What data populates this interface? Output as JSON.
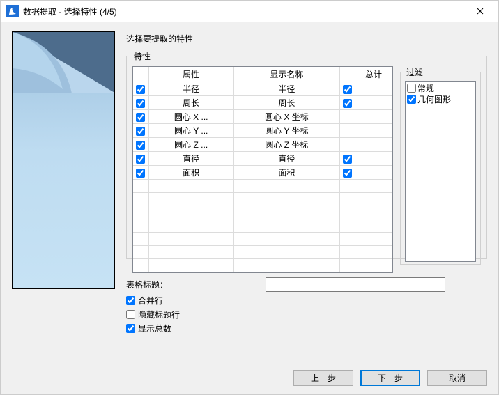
{
  "window": {
    "title": "数据提取 - 选择特性 (4/5)"
  },
  "instruction": "选择要提取的特性",
  "properties": {
    "legend": "特性",
    "headers": {
      "attr": "属性",
      "display": "显示名称",
      "total": "总计"
    },
    "rows": [
      {
        "checked": true,
        "attr": "半径",
        "display": "半径",
        "total": true
      },
      {
        "checked": true,
        "attr": "周长",
        "display": "周长",
        "total": true
      },
      {
        "checked": true,
        "attr": "圆心 X ...",
        "display": "圆心 X 坐标",
        "total": null
      },
      {
        "checked": true,
        "attr": "圆心 Y ...",
        "display": "圆心 Y 坐标",
        "total": null
      },
      {
        "checked": true,
        "attr": "圆心 Z ...",
        "display": "圆心 Z 坐标",
        "total": null
      },
      {
        "checked": true,
        "attr": "直径",
        "display": "直径",
        "total": true
      },
      {
        "checked": true,
        "attr": "面积",
        "display": "面积",
        "total": true
      }
    ]
  },
  "filter": {
    "legend": "过滤",
    "items": [
      {
        "label": "常规",
        "checked": false
      },
      {
        "label": "几何图形",
        "checked": true
      }
    ]
  },
  "form": {
    "title_label": "表格标题：",
    "title_value": "",
    "merge_rows": {
      "label": "合并行",
      "checked": true
    },
    "hide_header": {
      "label": "隐藏标题行",
      "checked": false
    },
    "show_totals": {
      "label": "显示总数",
      "checked": true
    }
  },
  "buttons": {
    "back": "上一步",
    "next": "下一步",
    "cancel": "取消"
  }
}
